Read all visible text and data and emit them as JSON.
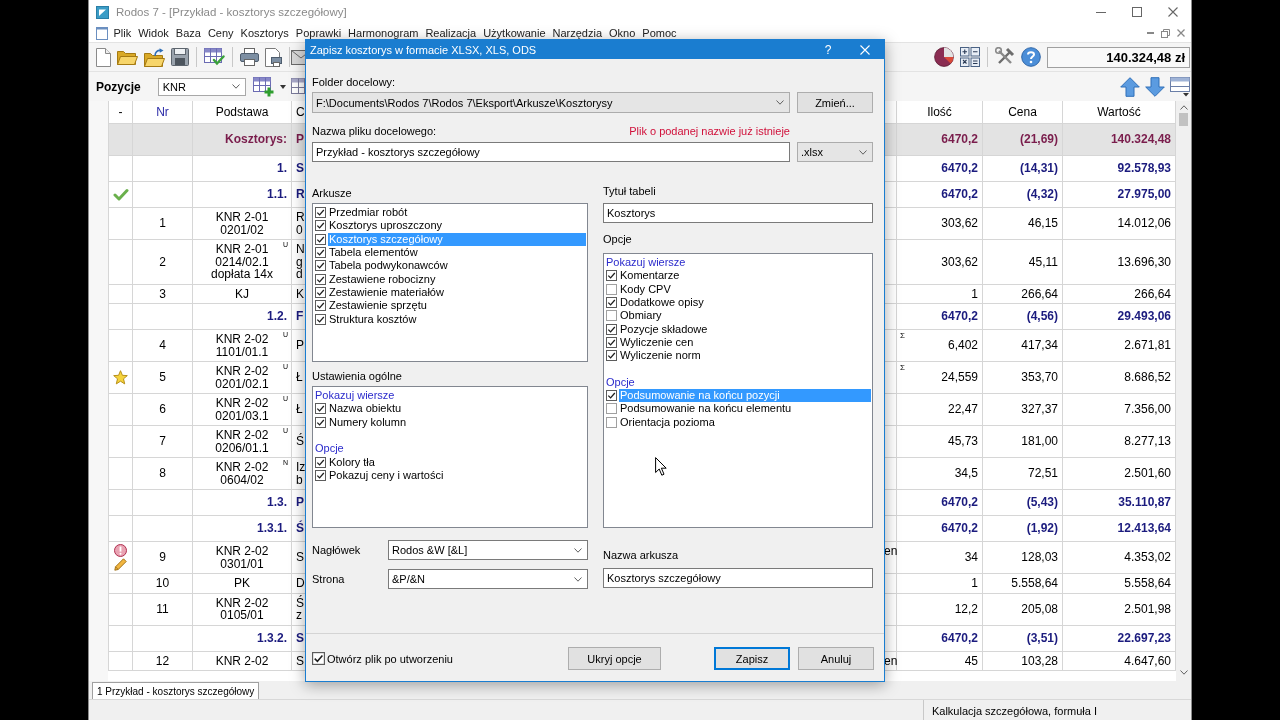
{
  "window": {
    "title": "Rodos 7 - [Przykład - kosztorys szczegółowy]"
  },
  "menu": [
    "Plik",
    "Widok",
    "Baza",
    "Ceny",
    "Kosztorys",
    "Poprawki",
    "Harmonogram",
    "Realizacja",
    "Użytkowanie",
    "Narzędzia",
    "Okno",
    "Pomoc"
  ],
  "toolbar": {
    "total": "140.324,48 zł"
  },
  "positions_bar": {
    "label": "Pozycje",
    "catalog": "KNR"
  },
  "table": {
    "columns": [
      {
        "label": "-",
        "highlighted": false
      },
      {
        "label": "Nr",
        "highlighted": true
      },
      {
        "label": "Podstawa",
        "highlighted": false
      },
      {
        "label": "C",
        "highlighted": false
      },
      {
        "label": "Ilość",
        "highlighted": false
      },
      {
        "label": "Cena",
        "highlighted": false
      },
      {
        "label": "Wartość",
        "highlighted": false
      }
    ],
    "rows": [
      {
        "kind": "total",
        "basis": "Kosztorys:",
        "column_4": "P",
        "quantity": "6470,2",
        "price": "(21,69)",
        "value": "140.324,48"
      },
      {
        "kind": "section",
        "basis": "1.",
        "column_4": "S",
        "quantity": "6470,2",
        "price": "(14,31)",
        "value": "92.578,93"
      },
      {
        "kind": "section",
        "markers": [
          {
            "kind": "check"
          }
        ],
        "basis": "1.1.",
        "column_4": "R",
        "quantity": "6470,2",
        "price": "(4,32)",
        "value": "27.975,00"
      },
      {
        "kind": "item",
        "nr": "1",
        "basis": "KNR 2-01\n0201/02",
        "column_4": "R\n0",
        "quantity": "303,62",
        "price": "46,15",
        "value": "14.012,06"
      },
      {
        "kind": "item",
        "nr": "2",
        "basis": "KNR 2-01\n0214/02.1\ndopłata 14x",
        "basis_mark": "U",
        "column_4": "N\ng\nd",
        "quantity": "303,62",
        "price": "45,11",
        "value": "13.696,30"
      },
      {
        "kind": "item",
        "nr": "3",
        "basis": "KJ",
        "column_4": "K",
        "quantity": "1",
        "price": "266,64",
        "value": "266,64"
      },
      {
        "kind": "section",
        "basis": "1.2.",
        "column_4": "F",
        "quantity": "6470,2",
        "price": "(4,56)",
        "value": "29.493,06"
      },
      {
        "kind": "item",
        "nr": "4",
        "basis": "KNR 2-02\n1101/01.1",
        "basis_mark": "U",
        "column_4": "P",
        "quantity_mark": "Σ",
        "quantity": "6,402",
        "price": "417,34",
        "value": "2.671,81"
      },
      {
        "kind": "item",
        "markers": [
          {
            "kind": "star"
          }
        ],
        "nr": "5",
        "basis": "KNR 2-02\n0201/02.1",
        "basis_mark": "U",
        "column_4": "Ł",
        "quantity_mark": "Σ",
        "quantity": "24,559",
        "price": "353,70",
        "value": "8.686,52"
      },
      {
        "kind": "item",
        "nr": "6",
        "basis": "KNR 2-02\n0201/03.1",
        "basis_mark": "U",
        "column_4": "Ł",
        "quantity": "22,47",
        "price": "327,37",
        "value": "7.356,00"
      },
      {
        "kind": "item",
        "nr": "7",
        "basis": "KNR 2-02\n0206/01.1",
        "basis_mark": "U",
        "column_4": "Ś",
        "quantity": "45,73",
        "price": "181,00",
        "value": "8.277,13"
      },
      {
        "kind": "item",
        "nr": "8",
        "basis": "KNR 2-02\n0604/02",
        "basis_mark": "N",
        "column_4": "Iz\nb",
        "quantity": "34,5",
        "price": "72,51",
        "value": "2.501,60"
      },
      {
        "kind": "section",
        "basis": "1.3.",
        "column_4": "P",
        "quantity": "6470,2",
        "price": "(5,43)",
        "value": "35.110,87"
      },
      {
        "kind": "section",
        "basis": "1.3.1.",
        "column_4": "Ś",
        "quantity": "6470,2",
        "price": "(1,92)",
        "value": "12.413,64"
      },
      {
        "kind": "item",
        "markers": [
          {
            "kind": "alert"
          },
          {
            "kind": "edit"
          }
        ],
        "nr": "9",
        "basis": "KNR 2-02\n0301/01",
        "column_4": "S",
        "column_5": "en",
        "quantity": "34",
        "price": "128,03",
        "value": "4.353,02"
      },
      {
        "kind": "item",
        "nr": "10",
        "basis": "PK",
        "column_4": "D",
        "quantity": "1",
        "price": "5.558,64",
        "value": "5.558,64"
      },
      {
        "kind": "item",
        "nr": "11",
        "basis": "KNR 2-02\n0105/01",
        "column_4": "Ś\nz",
        "quantity": "12,2",
        "price": "205,08",
        "value": "2.501,98"
      },
      {
        "kind": "section",
        "basis": "1.3.2.",
        "column_4": "S",
        "quantity": "6470,2",
        "price": "(3,51)",
        "value": "22.697,23"
      },
      {
        "kind": "item",
        "nr": "12",
        "basis": "KNR 2-02",
        "column_4": "S",
        "column_5": "en",
        "quantity": "45",
        "price": "103,28",
        "value": "4.647,60"
      }
    ]
  },
  "dialog": {
    "title": "Zapisz kosztorys w formacie XLSX, XLS, ODS",
    "help": "?",
    "folder": {
      "label": "Folder docelowy:",
      "value": "F:\\Documents\\Rodos 7\\Rodos 7\\Eksport\\Arkusze\\Kosztorysy",
      "button": "Zmień..."
    },
    "file_name": {
      "label": "Nazwa pliku docelowego:",
      "warning": "Plik o podanej nazwie już istnieje",
      "value": "Przykład - kosztorys szczegółowy",
      "format": ".xlsx"
    },
    "sheets": {
      "label": "Arkusze",
      "items": [
        {
          "label": "Przedmiar robót",
          "checked": true,
          "selected": false
        },
        {
          "label": "Kosztorys uproszczony",
          "checked": true,
          "selected": false
        },
        {
          "label": "Kosztorys szczegółowy",
          "checked": true,
          "selected": true
        },
        {
          "label": "Tabela elementów",
          "checked": true,
          "selected": false
        },
        {
          "label": "Tabela podwykonawców",
          "checked": true,
          "selected": false
        },
        {
          "label": "Zestawiene robocizny",
          "checked": true,
          "selected": false
        },
        {
          "label": "Zestawienie materiałów",
          "checked": true,
          "selected": false
        },
        {
          "label": "Zestawienie sprzętu",
          "checked": true,
          "selected": false
        },
        {
          "label": "Struktura kosztów",
          "checked": true,
          "selected": false
        }
      ]
    },
    "general_settings": {
      "label": "Ustawienia ogólne",
      "groups": [
        {
          "title": "Pokazuj wiersze",
          "items": [
            {
              "label": "Nazwa obiektu",
              "checked": true,
              "selected": false
            },
            {
              "label": "Numery kolumn",
              "checked": true,
              "selected": false
            }
          ]
        },
        {
          "title": "Opcje",
          "items": [
            {
              "label": "Kolory tła",
              "checked": true,
              "selected": false
            },
            {
              "label": "Pokazuj ceny i wartości",
              "checked": true,
              "selected": false
            }
          ]
        }
      ]
    },
    "header": {
      "label": "Nagłówek",
      "value": "Rodos &W [&L]"
    },
    "page": {
      "label": "Strona",
      "value": "&P/&N"
    },
    "table_title": {
      "label": "Tytuł tabeli",
      "value": "Kosztorys"
    },
    "options": {
      "label": "Opcje",
      "groups": [
        {
          "title": "Pokazuj wiersze",
          "items": [
            {
              "label": "Komentarze",
              "checked": true,
              "selected": false
            },
            {
              "label": "Kody CPV",
              "checked": false,
              "selected": false
            },
            {
              "label": "Dodatkowe opisy",
              "checked": true,
              "selected": false
            },
            {
              "label": "Obmiary",
              "checked": false,
              "selected": false
            },
            {
              "label": "Pozycje składowe",
              "checked": true,
              "selected": false
            },
            {
              "label": "Wyliczenie cen",
              "checked": true,
              "selected": false
            },
            {
              "label": "Wyliczenie norm",
              "checked": true,
              "selected": false
            }
          ]
        },
        {
          "title": "Opcje",
          "items": [
            {
              "label": "Podsumowanie na końcu pozycji",
              "checked": true,
              "selected": true
            },
            {
              "label": "Podsumowanie na końcu elementu",
              "checked": false,
              "selected": false
            },
            {
              "label": "Orientacja pozioma",
              "checked": false,
              "selected": false
            }
          ]
        }
      ]
    },
    "sheet_name": {
      "label": "Nazwa arkusza",
      "value": "Kosztorys szczegółowy"
    },
    "open_after": {
      "label": "Otwórz plik po utworzeniu",
      "checked": true
    },
    "buttons": [
      {
        "label": "Ukryj opcje",
        "kind": "toggle"
      },
      {
        "label": "Zapisz",
        "kind": "default"
      },
      {
        "label": "Anuluj",
        "kind": "cancel"
      }
    ]
  },
  "document_tabs": [
    {
      "label": "1 Przykład - kosztorys szczegółowy",
      "selected": true
    }
  ],
  "status_bar": {
    "text": "Kalkulacja szczegółowa, formuła I"
  }
}
